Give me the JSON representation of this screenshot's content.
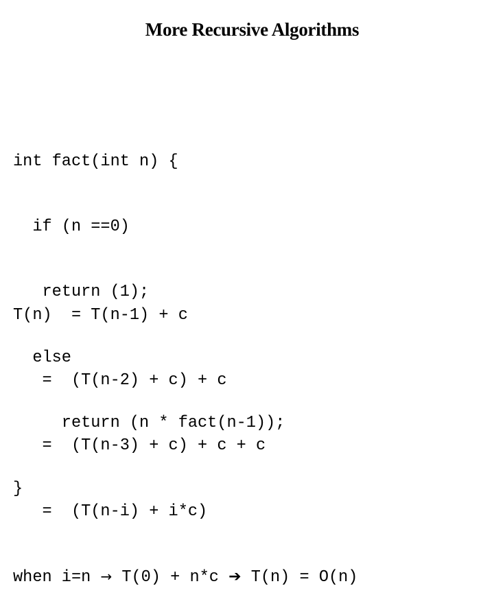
{
  "slide": {
    "title": "More Recursive Algorithms",
    "code_block": [
      "int fact(int n) {",
      "  if (n ==0)",
      "   return (1);",
      "  else",
      "     return (n * fact(n-1));",
      "}"
    ],
    "analysis": [
      "T(n)  = T(n-1) + c",
      "   =  (T(n-2) + c) + c",
      "   =  (T(n-3) + c) + c + c",
      "   =  (T(n-i) + i*c)"
    ],
    "conclusion": {
      "part1": "when i=n ",
      "arrow1": "→",
      "part2": " T(0) + n*c ",
      "arrow2": "➔",
      "part3": " T(n) = O(n)"
    }
  }
}
